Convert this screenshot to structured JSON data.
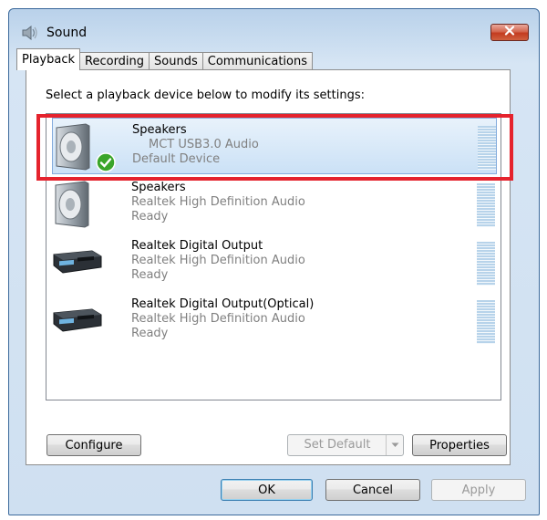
{
  "window": {
    "title": "Sound",
    "icon": "speaker-icon",
    "close_icon": "close-icon"
  },
  "tabs": [
    {
      "label": "Playback",
      "active": true
    },
    {
      "label": "Recording",
      "active": false
    },
    {
      "label": "Sounds",
      "active": false
    },
    {
      "label": "Communications",
      "active": false
    }
  ],
  "instruction": "Select a playback device below to modify its settings:",
  "devices": [
    {
      "name": "Speakers",
      "description": "MCT USB3.0 Audio",
      "status": "Default Device",
      "icon": "speaker-icon",
      "default": true,
      "selected": true
    },
    {
      "name": "Speakers",
      "description": "Realtek High Definition Audio",
      "status": "Ready",
      "icon": "speaker-icon",
      "default": false,
      "selected": false
    },
    {
      "name": "Realtek Digital Output",
      "description": "Realtek High Definition Audio",
      "status": "Ready",
      "icon": "digital-output-icon",
      "default": false,
      "selected": false
    },
    {
      "name": "Realtek Digital Output(Optical)",
      "description": "Realtek High Definition Audio",
      "status": "Ready",
      "icon": "digital-output-icon",
      "default": false,
      "selected": false
    }
  ],
  "buttons": {
    "configure": "Configure",
    "set_default": "Set Default",
    "properties": "Properties",
    "ok": "OK",
    "cancel": "Cancel",
    "apply": "Apply"
  },
  "colors": {
    "highlight_border": "#e5232d",
    "selection": "#cbe1f6",
    "default_check": "#3aa52a"
  }
}
